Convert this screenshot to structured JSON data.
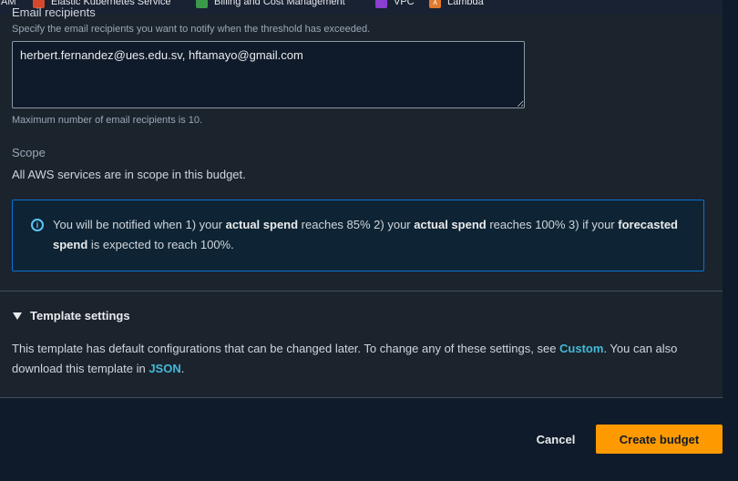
{
  "favorites": [
    {
      "label": "IAM",
      "icon": "iam-icon"
    },
    {
      "label": "Elastic Kubernetes Service",
      "icon": "eks-icon"
    },
    {
      "label": "Billing and Cost Management",
      "icon": "billing-icon"
    },
    {
      "label": "VPC",
      "icon": "vpc-icon"
    },
    {
      "label": "Lambda",
      "icon": "lambda-icon"
    }
  ],
  "email": {
    "label": "Email recipients",
    "description": "Specify the email recipients you want to notify when the threshold has exceeded.",
    "value": "herbert.fernandez@ues.edu.sv, hftamayo@gmail.com",
    "constraint": "Maximum number of email recipients is 10."
  },
  "scope": {
    "label": "Scope",
    "text": "All AWS services are in scope in this budget."
  },
  "alert": {
    "p1": "You will be notified when 1) your ",
    "b1": "actual spend",
    "p2": " reaches 85% 2) your ",
    "b2": "actual spend",
    "p3": " reaches 100% 3) if your ",
    "b3": "forecasted spend",
    "p4": " is expected to reach 100%."
  },
  "template": {
    "title": "Template settings",
    "text1": "This template has default configurations that can be changed later. To change any of these settings, see ",
    "link1": "Custom",
    "text2": ". You can also download this template in ",
    "link2": "JSON",
    "text3": "."
  },
  "actions": {
    "cancel": "Cancel",
    "create": "Create budget"
  },
  "colors": {
    "primary_button": "#ff9900",
    "link": "#44b9d6",
    "info_border": "#0972d3",
    "info_icon": "#5fc3f5"
  }
}
